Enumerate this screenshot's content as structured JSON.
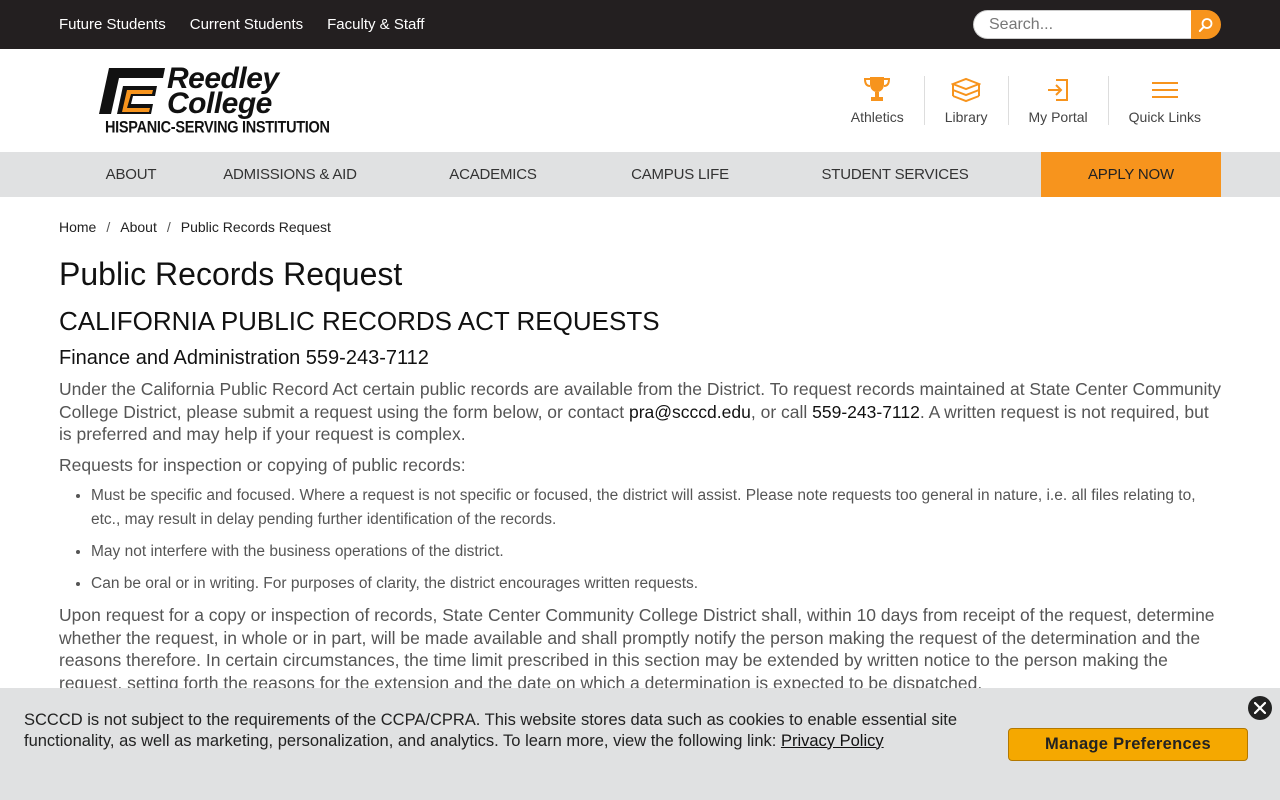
{
  "topbar": {
    "links": [
      "Future Students",
      "Current Students",
      "Faculty & Staff"
    ],
    "search_placeholder": "Search..."
  },
  "logo": {
    "line1": "Reedley",
    "line2": "College",
    "tagline": "HISPANIC-SERVING INSTITUTION"
  },
  "quick_nav": [
    {
      "label": "Athletics",
      "icon": "trophy-icon"
    },
    {
      "label": "Library",
      "icon": "books-icon"
    },
    {
      "label": "My Portal",
      "icon": "sign-in-icon"
    },
    {
      "label": "Quick Links",
      "icon": "menu-icon"
    }
  ],
  "main_nav": [
    "ABOUT",
    "ADMISSIONS & AID",
    "ACADEMICS",
    "CAMPUS LIFE",
    "STUDENT SERVICES"
  ],
  "apply_label": "APPLY NOW",
  "breadcrumb": [
    "Home",
    "About",
    "Public Records Request"
  ],
  "page_title": "Public Records Request",
  "section_title": "CALIFORNIA PUBLIC RECORDS ACT REQUESTS",
  "subsection_title": "Finance and Administration 559-243-7112",
  "intro": {
    "part1": "Under the California Public Record Act certain public records are available from the District. To request records maintained at State Center Community College District, please submit a request using the form below, or contact ",
    "email": "pra@scccd.edu",
    "part2": ", or call ",
    "phone": "559-243-7112",
    "part3": ". A written request is not required, but is preferred and may help if your request is complex."
  },
  "requests_intro": "Requests for inspection or copying of public records:",
  "requirements": [
    "Must be specific and focused. Where a request is not specific or focused, the district will assist. Please note requests too general in nature, i.e. all files relating to, etc., may result in delay pending further identification of the records.",
    "May not interfere with the business operations of the district.",
    "Can be oral or in writing. For purposes of clarity, the district encourages written requests."
  ],
  "response_paragraph": "Upon request for a copy or inspection of records, State Center Community College District shall, within 10 days from receipt of the request, determine whether the request, in whole or in part, will be made available and shall promptly notify the person making the request of the determination and the reasons therefore. In certain circumstances, the time limit prescribed in this section may be extended by written notice to the person making the request, setting forth the reasons for the extension and the date on which a determination is expected to be dispatched.",
  "cookie": {
    "message": "SCCCD is not subject to the requirements of the CCPA/CPRA. This website stores data such as cookies to enable essential site functionality, as well as marketing, personalization, and analytics. To learn more, view the following link: ",
    "link": "Privacy Policy",
    "button": "Manage Preferences"
  },
  "colors": {
    "topbar": "#231f20",
    "accent": "#f7941d",
    "nav_bg": "#e0e1e2",
    "cookie_button": "#f5a800"
  }
}
